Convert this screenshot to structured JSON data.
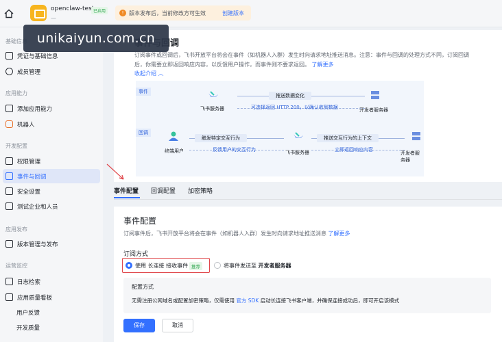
{
  "topbar": {
    "app_name": "openclaw-test",
    "app_badge": "已启用",
    "app_sub": "—",
    "notice_text": "版本发布后，当前修改方可生效",
    "notice_link": "创建版本"
  },
  "watermark": "unikaiyun.com.cn",
  "sidebar": {
    "groups": [
      "基础信息",
      "应用能力",
      "开发配置",
      "应用发布",
      "运营监控"
    ],
    "items": [
      {
        "label": "凭证与基础信息"
      },
      {
        "label": "成员管理"
      },
      {
        "label": "添加应用能力"
      },
      {
        "label": "机器人"
      },
      {
        "label": "权限管理"
      },
      {
        "label": "事件与回调"
      },
      {
        "label": "安全设置"
      },
      {
        "label": "测试企业和人员"
      },
      {
        "label": "版本管理与发布"
      },
      {
        "label": "日志检索"
      },
      {
        "label": "应用质量看板"
      },
      {
        "label": "用户反馈"
      },
      {
        "label": "开发质量"
      }
    ]
  },
  "main": {
    "title": "事件与回调",
    "desc": "订阅事件或回调后，飞书开放平台将会在事件（如机器人入群）发生时向请求地址推送消息。注意：事件与回调的处理方式不同，订阅回调后，你需要立即返回响应内容，以反馈用户操作，而事件则不要求返回。",
    "desc_link": "了解更多",
    "collapse": "收起介绍",
    "diagram": {
      "event_label": "事件",
      "callback_label": "回调",
      "feishu_server": "飞书服务器",
      "dev_server": "开发者服务器",
      "end_user": "终端用户",
      "push_data": "推送数据变化",
      "return_http": "可选择返回 HTTP 200，以确认收到数据",
      "trigger": "触发特定交互行为",
      "feedback": "反馈用户的交互行为",
      "push_context": "推送交互行为的上下文",
      "return_resp": "立即返回响应内容"
    },
    "tabs": [
      {
        "label": "事件配置"
      },
      {
        "label": "回调配置"
      },
      {
        "label": "加密策略"
      }
    ],
    "event_config": {
      "title": "事件配置",
      "desc": "订阅事件后，飞书开放平台将会在事件（如机器人入群）发生时向请求地址推送消息",
      "desc_link": "了解更多",
      "sub_label": "订阅方式",
      "option1_pre": "使用",
      "option1_mid": "长连接",
      "option1_post": "接收事件",
      "option1_badge": "推荐",
      "option2_pre": "将事件发送至",
      "option2_bold": "开发者服务器",
      "info_title": "配置方式",
      "info_text_pre": "无需注册公网域名或配置加密策略，仅需使用",
      "info_link": "官方 SDK",
      "info_text_post": "启动长连接飞书客户端，并确保连接成功后，即可开启该模式",
      "save": "保存",
      "cancel": "取消"
    }
  }
}
